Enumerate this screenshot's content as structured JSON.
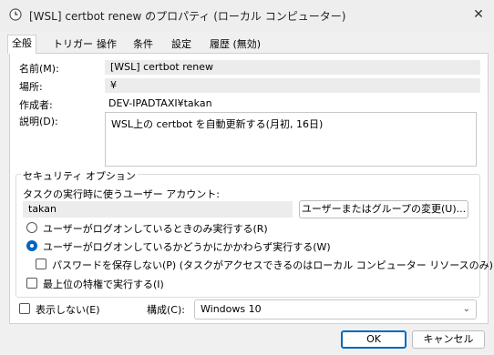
{
  "window": {
    "title": "[WSL] certbot renew のプロパティ (ローカル コンピューター)",
    "close_glyph": "✕",
    "icon": "clock-icon"
  },
  "tabs": [
    {
      "label": "全般",
      "active": true
    },
    {
      "label": "トリガー",
      "active": false
    },
    {
      "label": "操作",
      "active": false
    },
    {
      "label": "条件",
      "active": false
    },
    {
      "label": "設定",
      "active": false
    },
    {
      "label": "履歴 (無効)",
      "active": false
    }
  ],
  "general": {
    "name_label": "名前(M):",
    "name_value": "[WSL] certbot renew",
    "location_label": "場所:",
    "location_value": "¥",
    "author_label": "作成者:",
    "author_value": "DEV-IPADTAXI¥takan",
    "description_label": "説明(D):",
    "description_value": "WSL上の certbot を自動更新する(月初, 16日)"
  },
  "security": {
    "group_title": "セキュリティ オプション",
    "account_prompt": "タスクの実行時に使うユーザー アカウント:",
    "account_value": "takan",
    "change_user_button": "ユーザーまたはグループの変更(U)...",
    "radio_logged_on_only": "ユーザーがログオンしているときのみ実行する(R)",
    "radio_whether_or_not": "ユーザーがログオンしているかどうかにかかわらず実行する(W)",
    "radio_selected": "whether_or_not",
    "no_store_password": "パスワードを保存しない(P) (タスクがアクセスできるのはローカル コンピューター リソースのみ)",
    "highest_privileges": "最上位の特権で実行する(I)"
  },
  "bottom": {
    "hidden_label": "表示しない(E)",
    "config_label": "構成(C):",
    "config_value": "Windows 10"
  },
  "buttons": {
    "ok": "OK",
    "cancel": "キャンセル"
  },
  "colors": {
    "accent": "#0067c0"
  }
}
